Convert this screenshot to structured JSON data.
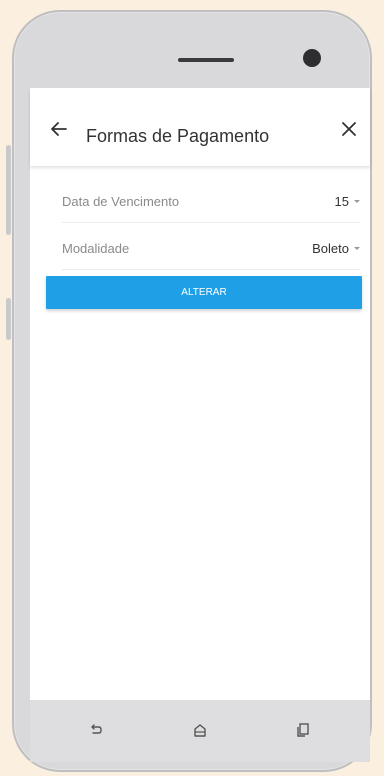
{
  "appbar": {
    "title": "Formas de Pagamento",
    "back_icon": "arrow-left-icon",
    "close_icon": "close-icon"
  },
  "form": {
    "fields": [
      {
        "label": "Data de Vencimento",
        "value": "15"
      },
      {
        "label": "Modalidade",
        "value": "Boleto"
      }
    ],
    "submit_label": "ALTERAR"
  },
  "navbar": {
    "icons": [
      "back-nav-icon",
      "home-nav-icon",
      "recents-nav-icon"
    ]
  },
  "colors": {
    "accent": "#1fa0e6",
    "background": "#fbefdf"
  }
}
